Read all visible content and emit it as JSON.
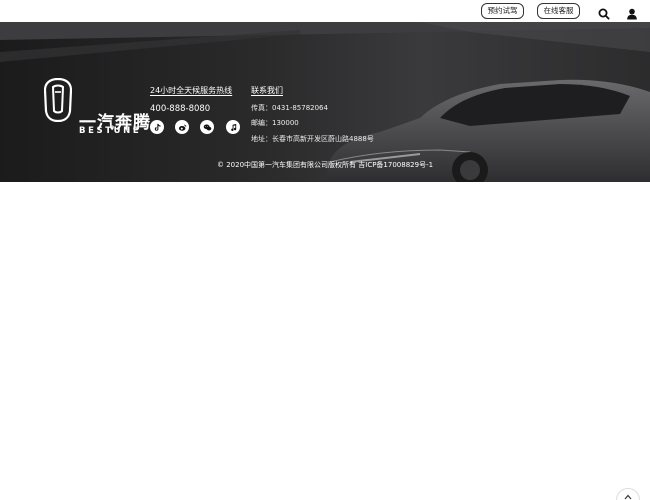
{
  "header": {
    "test_drive_label": "预约试驾",
    "online_service_label": "在线客服",
    "search_icon": "search-icon",
    "user_icon": "user-icon"
  },
  "footer": {
    "logo": {
      "cn": "一汽奔腾",
      "en": "BESTUNE"
    },
    "hotline": {
      "title": "24小时全天候服务热线",
      "number": "400-888-8080"
    },
    "social_icons": [
      "douyin-icon",
      "weibo-icon",
      "wechat-icon",
      "music-icon"
    ],
    "contact": {
      "title": "联系我们",
      "fax": "传真：0431-85782064",
      "postcode": "邮编：130000",
      "address": "地址：长春市高新开发区蔚山路4888号"
    },
    "copyright": "© 2020中国第一汽车集团有限公司版权所有 吉ICP备17008829号-1"
  },
  "floating": {
    "icon": "scroll-up-icon"
  },
  "colors": {
    "footer_bg": "#2a2a2b",
    "text_light": "#ffffff",
    "border_dark": "#333333"
  }
}
